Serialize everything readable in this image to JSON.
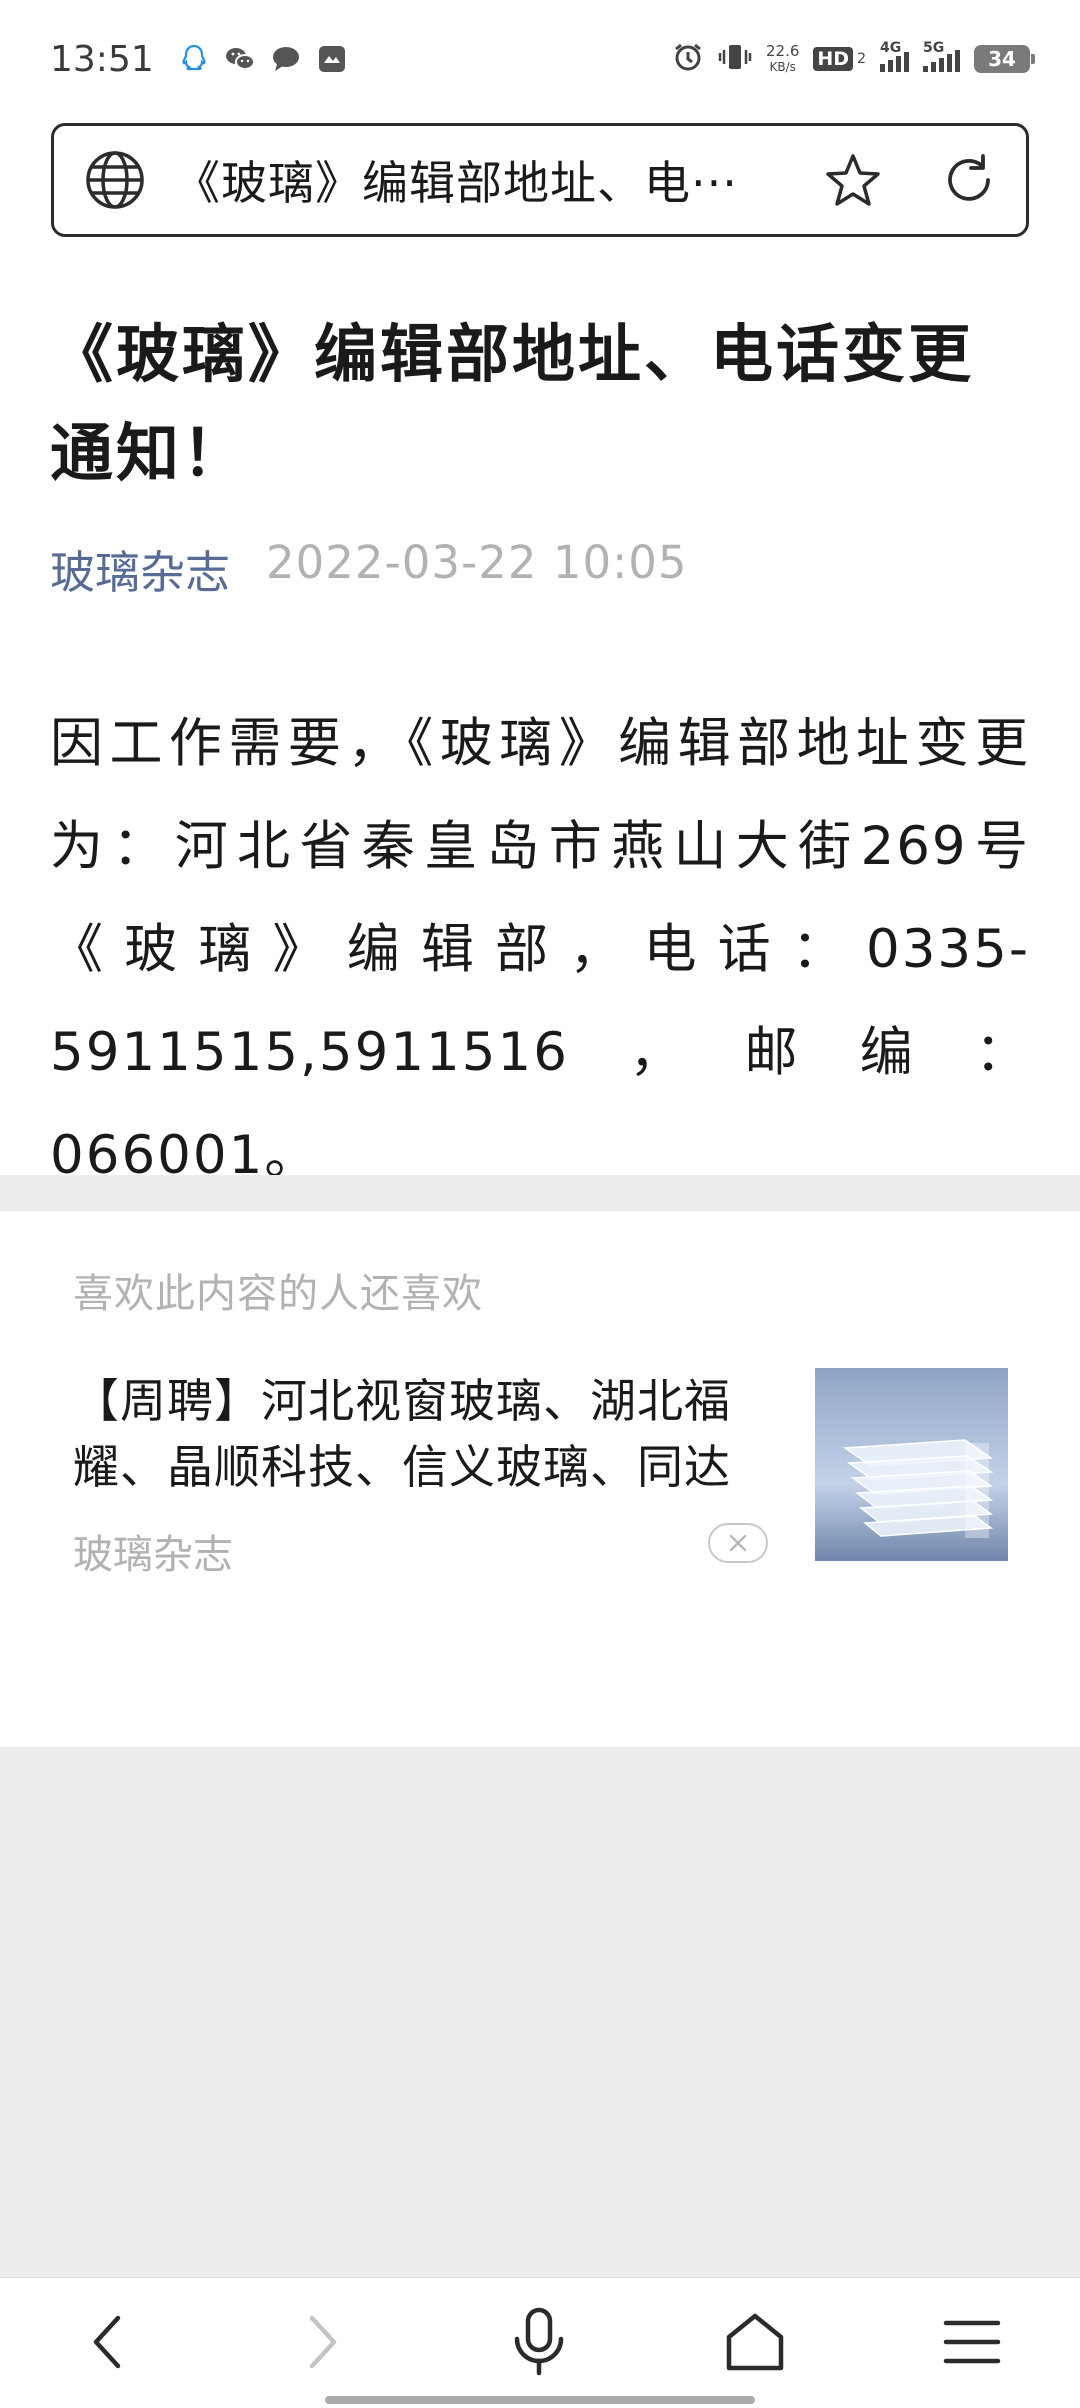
{
  "status_bar": {
    "time": "13:51",
    "net_speed": "22.6",
    "net_unit": "KB/s",
    "hd_label": "HD",
    "hd_sub": "2",
    "sim1_label": "4G",
    "sim2_label": "5G",
    "battery": "34",
    "app_icons": [
      "qq-icon",
      "wechat-icon",
      "message-icon",
      "mail-icon"
    ],
    "system_icons": [
      "alarm-icon",
      "vibrate-icon"
    ]
  },
  "url_bar": {
    "title": "《玻璃》编辑部地址、电···",
    "icons": [
      "globe-icon",
      "star-icon",
      "refresh-icon"
    ]
  },
  "article": {
    "title": "《玻璃》编辑部地址、电话变更通知！",
    "source": "玻璃杂志",
    "date": "2022-03-22 10:05",
    "body": "因工作需要，《玻璃》编辑部地址变更为：河北省秦皇岛市燕山大街269号《玻璃》编辑部，电话：0335-5911515,5911516，邮编：066001。"
  },
  "related": {
    "heading": "喜欢此内容的人还喜欢",
    "items": [
      {
        "title": "【周聘】河北视窗玻璃、湖北福耀、晶顺科技、信义玻璃、同达",
        "source": "玻璃杂志"
      }
    ]
  },
  "bottom_bar": {
    "icons": [
      "back-icon",
      "forward-icon",
      "microphone-icon",
      "home-icon",
      "menu-icon"
    ]
  },
  "colors": {
    "accent_link": "#576b95",
    "muted_text": "#b2b2b2",
    "gray_background": "#ededed"
  }
}
